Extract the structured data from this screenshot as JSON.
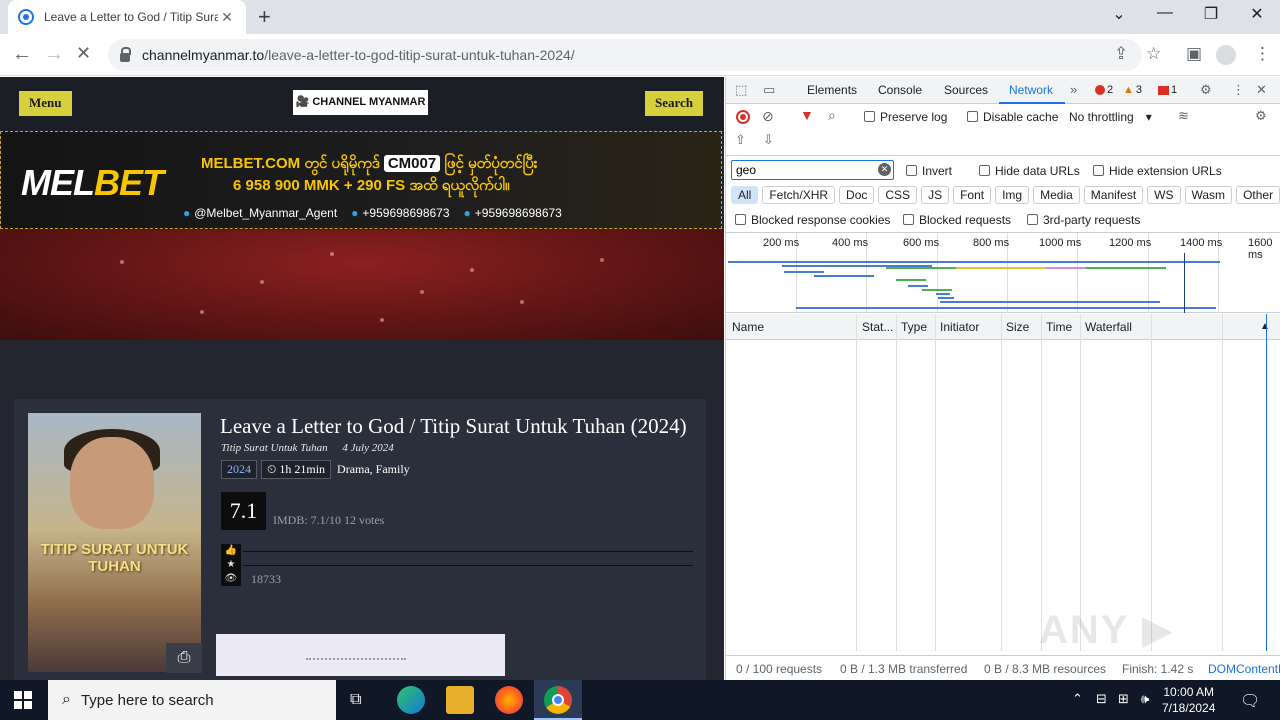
{
  "browser": {
    "tab_title": "Leave a Letter to God / Titip Surat",
    "url_host": "channelmyanmar.to",
    "url_path": "/leave-a-letter-to-god-titip-surat-untuk-tuhan-2024/"
  },
  "site": {
    "menu_label": "Menu",
    "search_label": "Search",
    "logo_text": "CHANNEL MYANMAR",
    "banner": {
      "brand_a": "MEL",
      "brand_b": "BET",
      "line1_a": "MELBET.COM တွင် ပရိုမိုကုဒ်",
      "line1_code": "CM007",
      "line1_b": "ဖြင့် မှတ်ပုံတင်ပြီး",
      "line2": "6 958 900 MMK + 290 FS အထိ ရယူလိုက်ပါ။",
      "telegram": "@Melbet_Myanmar_Agent",
      "viber": "+959698698673",
      "whatsapp": "+959698698673"
    },
    "movie": {
      "title": "Leave a Letter to God / Titip Surat Untuk Tuhan (2024)",
      "original_title": "Titip Surat Untuk Tuhan",
      "release_date": "4 July 2024",
      "year": "2024",
      "duration": "⏲ 1h 21min",
      "genres": "Drama, Family",
      "rating": "7.1",
      "imdb": "IMDB: 7.1/10   12 votes",
      "views": "18733",
      "poster_title": "TITIP SURAT UNTUK TUHAN"
    }
  },
  "devtools": {
    "tabs": [
      "Elements",
      "Console",
      "Sources",
      "Network"
    ],
    "errors": "2",
    "warnings": "3",
    "issues": "1",
    "preserve_log": "Preserve log",
    "disable_cache": "Disable cache",
    "throttling": "No throttling",
    "filter_value": "geo",
    "invert": "Invert",
    "hide_data_urls": "Hide data URLs",
    "hide_ext_urls": "Hide extension URLs",
    "type_filters": [
      "All",
      "Fetch/XHR",
      "Doc",
      "CSS",
      "JS",
      "Font",
      "Img",
      "Media",
      "Manifest",
      "WS",
      "Wasm",
      "Other"
    ],
    "blocked_cookies": "Blocked response cookies",
    "blocked_requests": "Blocked requests",
    "third_party": "3rd-party requests",
    "ticks": [
      "200 ms",
      "400 ms",
      "600 ms",
      "800 ms",
      "1000 ms",
      "1200 ms",
      "1400 ms",
      "1600 ms"
    ],
    "columns": [
      "Name",
      "Stat...",
      "Type",
      "Initiator",
      "Size",
      "Time",
      "Waterfall"
    ],
    "status_requests": "0 / 100 requests",
    "status_transferred": "0 B / 1.3 MB transferred",
    "status_resources": "0 B / 8.3 MB resources",
    "status_finish": "Finish: 1.42 s",
    "status_dom": "DOMContentLoaded",
    "watermark": "ANY ▶ RUN"
  },
  "taskbar": {
    "search_placeholder": "Type here to search",
    "time": "10:00 AM",
    "date": "7/18/2024"
  }
}
